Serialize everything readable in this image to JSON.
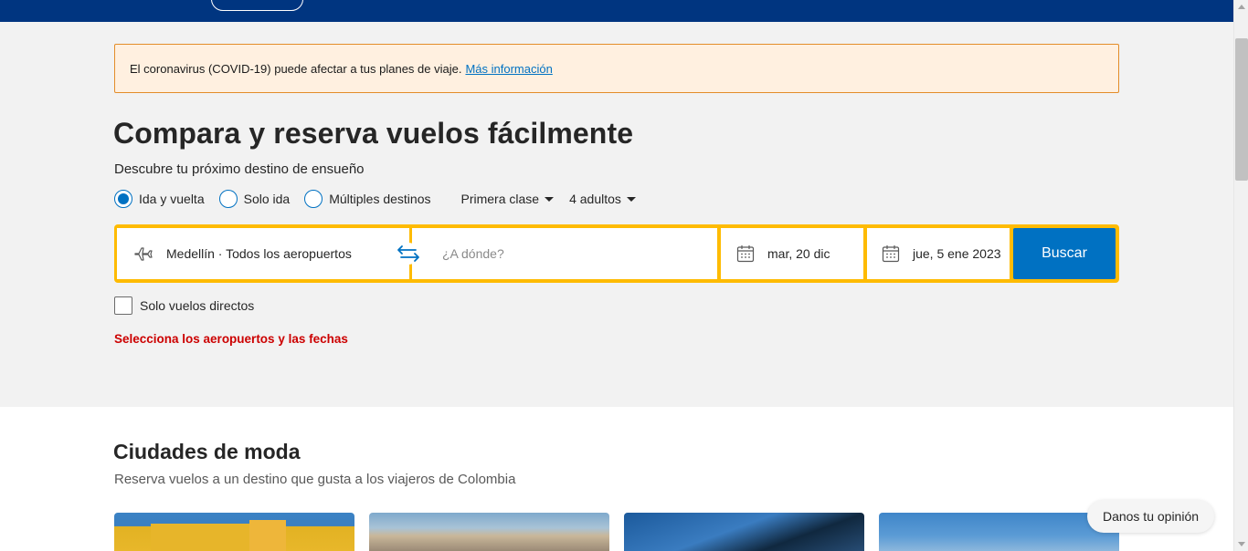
{
  "covid_banner": {
    "text": "El coronavirus (COVID-19) puede afectar a tus planes de viaje.",
    "link": "Más información"
  },
  "hero": {
    "title": "Compara y reserva vuelos fácilmente",
    "subtitle": "Descubre tu próximo destino de ensueño"
  },
  "trip_type": {
    "options": [
      {
        "label": "Ida y vuelta",
        "selected": true
      },
      {
        "label": "Solo ida",
        "selected": false
      },
      {
        "label": "Múltiples destinos",
        "selected": false
      }
    ],
    "cabin_class": "Primera clase",
    "passengers": "4 adultos"
  },
  "search": {
    "origin": "Medellín · Todos los aeropuertos",
    "destination_placeholder": "¿A dónde?",
    "depart_date": "mar, 20 dic",
    "return_date": "jue, 5 ene 2023",
    "button_label": "Buscar",
    "icons": {
      "origin": "plane-icon",
      "swap": "swap-arrows-icon",
      "date": "calendar-icon"
    }
  },
  "filters": {
    "direct_only_label": "Solo vuelos directos",
    "direct_only_checked": false
  },
  "error_message": "Selecciona los aeropuertos y las fechas",
  "trending": {
    "title": "Ciudades de moda",
    "subtitle": "Reserva vuelos a un destino que gusta a los viajeros de Colombia",
    "cards_count": 4
  },
  "feedback_button": "Danos tu opinión",
  "colors": {
    "nav_blue": "#003580",
    "accent_blue": "#0071c2",
    "search_yellow": "#febb02",
    "error_red": "#cc0000",
    "banner_bg": "#fff0e0",
    "banner_border": "#e38d29"
  }
}
